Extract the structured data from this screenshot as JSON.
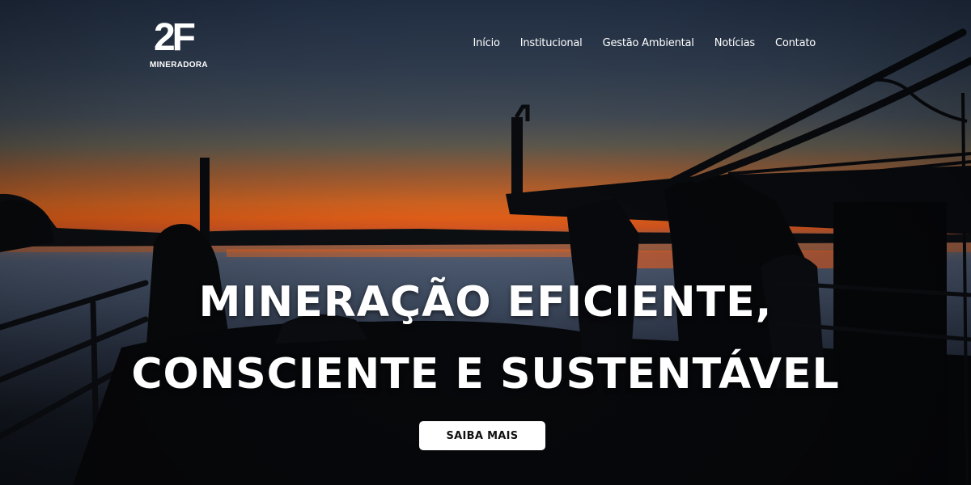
{
  "brand": {
    "logo_mark": "2F",
    "logo_sub": "MINERADORA"
  },
  "nav": {
    "items": [
      {
        "label": "Início"
      },
      {
        "label": "Institucional"
      },
      {
        "label": "Gestão Ambiental"
      },
      {
        "label": "Notícias"
      },
      {
        "label": "Contato"
      }
    ]
  },
  "hero": {
    "headline_line1": "MINERAÇÃO EFICIENTE,",
    "headline_line2": "CONSCIENTE E SUSTENTÁVEL",
    "cta_label": "SAIBA MAIS",
    "image": "sunset silhouette of a dredging barge on a river"
  },
  "colors": {
    "text": "#ffffff",
    "button_bg": "#ffffff",
    "button_text": "#111111",
    "sunset_orange": "#f4661a",
    "sky_top": "#2b3c57"
  }
}
